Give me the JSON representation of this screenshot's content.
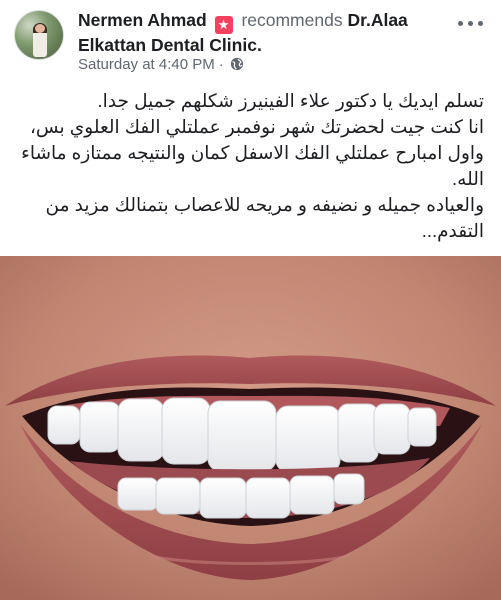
{
  "author": {
    "name": "Nermen Ahmad",
    "action": "recommends",
    "page": "Dr.Alaa Elkattan Dental Clinic",
    "page_suffix": "."
  },
  "meta": {
    "timestamp": "Saturday at 4:40 PM",
    "separator": "·",
    "audience_icon": "globe-icon"
  },
  "menu": {
    "icon": "more-options-icon"
  },
  "post_text": [
    "تسلم ايديك يا دكتور علاء الفينيرز شكلهم جميل جدا.",
    "انا كنت جيت لحضرتك شهر نوفمبر عملتلي الفك العلوي بس،",
    "واول امبارح عملتلي الفك الاسفل كمان والنتيجه ممتازه ماشاء الله.",
    "والعياده جميله و نضيفه و مريحه للاعصاب بتمنالك مزيد من التقدم..."
  ],
  "colors": {
    "recommend_badge": "#f3425f",
    "muted": "#606770",
    "text": "#1c1e21"
  },
  "photo": {
    "subject": "smile-with-veneers"
  }
}
